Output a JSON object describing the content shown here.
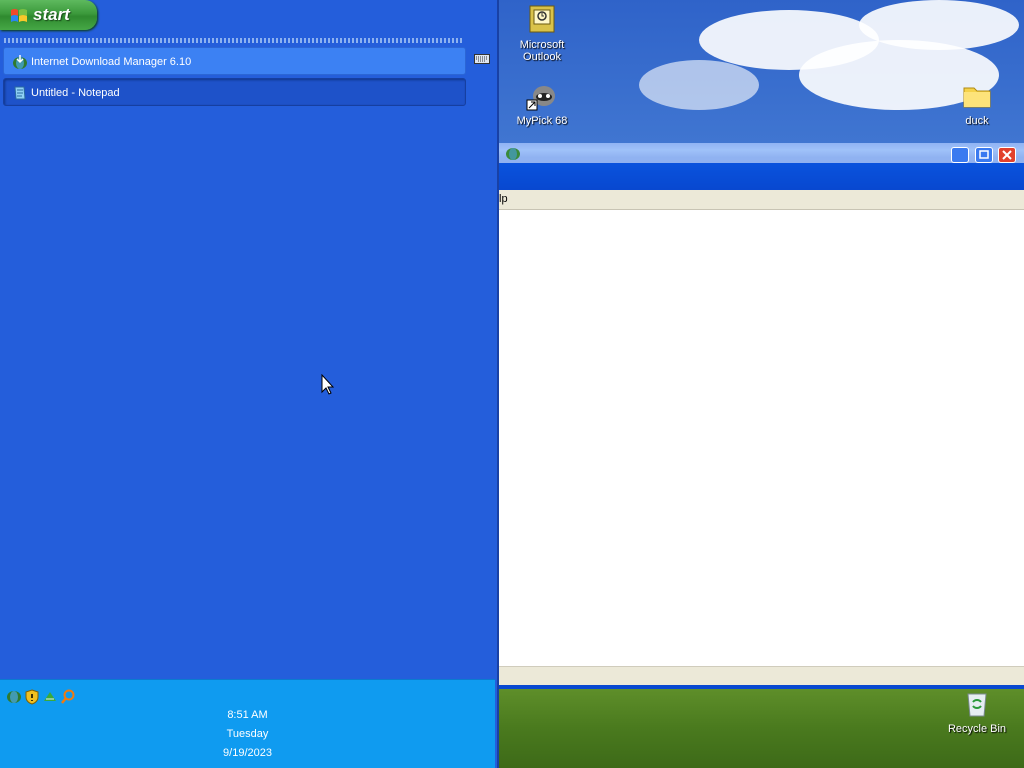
{
  "taskbar": {
    "start_label": "start",
    "tasks": [
      {
        "label": "Internet Download Manager 6.10",
        "icon": "idm-icon"
      },
      {
        "label": "Untitled - Notepad",
        "icon": "notepad-icon"
      }
    ],
    "tray_icons": [
      "idm-tray-icon",
      "security-shield-icon",
      "network-icon",
      "search-icon"
    ],
    "clock": {
      "time": "8:51 AM",
      "day": "Tuesday",
      "date": "9/19/2023"
    }
  },
  "desktop": {
    "icons": [
      {
        "label": "Microsoft Outlook",
        "icon": "outlook-icon"
      },
      {
        "label": "MyPick 68",
        "icon": "mypick-icon"
      },
      {
        "label": "duck",
        "icon": "folder-icon"
      },
      {
        "label": "Recycle Bin",
        "icon": "recycle-bin-icon"
      }
    ]
  },
  "window": {
    "menu_fragment": "lp"
  },
  "colors": {
    "taskbar": "#245edb",
    "tray": "#0f9bf0",
    "start_green": "#3c9a3c",
    "titlebar": "#0a55e0",
    "close_red": "#e2412c"
  }
}
